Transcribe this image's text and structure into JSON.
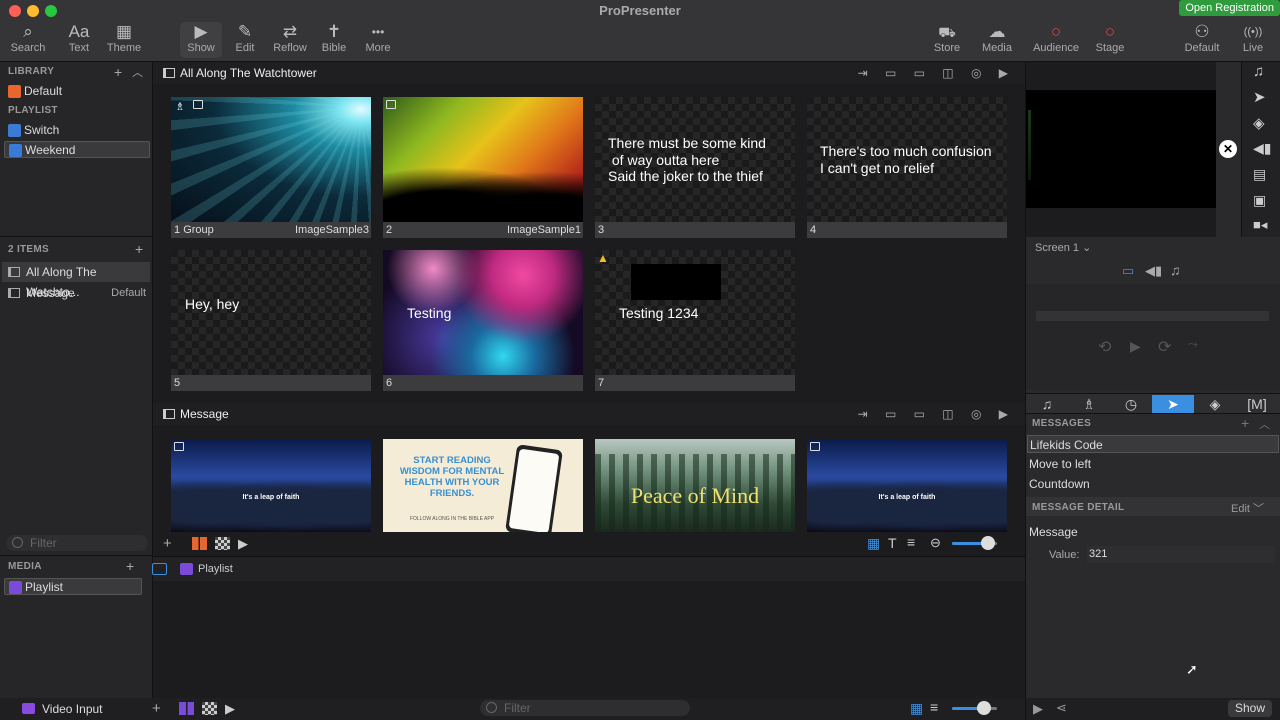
{
  "app": {
    "title": "ProPresenter",
    "registration": "Open Registration"
  },
  "toolbar": {
    "left": [
      {
        "label": "Search",
        "icon": "search-icon",
        "glyph": "⌕"
      },
      {
        "label": "Text",
        "icon": "text-icon",
        "glyph": "Aa"
      },
      {
        "label": "Theme",
        "icon": "theme-icon",
        "glyph": "▦"
      }
    ],
    "center": [
      {
        "label": "Show",
        "icon": "play-icon",
        "glyph": "▶"
      },
      {
        "label": "Edit",
        "icon": "pencil-icon",
        "glyph": "✎"
      },
      {
        "label": "Reflow",
        "icon": "reflow-icon",
        "glyph": "⇄"
      },
      {
        "label": "Bible",
        "icon": "bible-icon",
        "glyph": "✝"
      },
      {
        "label": "More",
        "icon": "more-icon",
        "glyph": "•••"
      }
    ],
    "right": [
      {
        "label": "Store",
        "icon": "store-icon",
        "glyph": "🛒"
      },
      {
        "label": "Media",
        "icon": "media-icon",
        "glyph": "☁"
      },
      {
        "label": "Audience",
        "icon": "audience-icon",
        "glyph": "○"
      },
      {
        "label": "Stage",
        "icon": "stage-icon",
        "glyph": "○"
      },
      {
        "label": "Default",
        "icon": "mask-icon",
        "glyph": "⚇"
      },
      {
        "label": "Live",
        "icon": "live-icon",
        "glyph": "((•))"
      }
    ]
  },
  "library": {
    "header": "LIBRARY",
    "items": [
      {
        "label": "Default"
      }
    ]
  },
  "playlist": {
    "header": "PLAYLIST",
    "items": [
      {
        "label": "Switch"
      },
      {
        "label": "Weekend"
      }
    ]
  },
  "items": {
    "header": "2 ITEMS",
    "list": [
      {
        "label": "All Along The Watchto...",
        "right": ""
      },
      {
        "label": "Message",
        "right": "Default"
      }
    ]
  },
  "filter_placeholder": "Filter",
  "media": {
    "header": "MEDIA",
    "items": [
      {
        "label": "Playlist"
      }
    ],
    "video_input": "Video Input"
  },
  "presentation": {
    "title": "All Along The Watchtower",
    "slides": [
      {
        "num": "1",
        "group": "Group",
        "name": "ImageSample3",
        "text": ""
      },
      {
        "num": "2",
        "group": "",
        "name": "ImageSample1",
        "text": ""
      },
      {
        "num": "3",
        "group": "",
        "name": "",
        "text": "There must be some kind\n of way outta here\nSaid the joker to the thief"
      },
      {
        "num": "4",
        "group": "",
        "name": "",
        "text": "There's too much confusion\nI can't get no relief"
      },
      {
        "num": "5",
        "group": "",
        "name": "",
        "text": "Hey, hey"
      },
      {
        "num": "6",
        "group": "",
        "name": "",
        "text": "Testing"
      },
      {
        "num": "7",
        "group": "",
        "name": "",
        "text": "Testing 1234"
      }
    ]
  },
  "message_section": {
    "title": "Message",
    "thumbs": [
      {
        "caption": "It's a leap of faith"
      },
      {
        "caption": "START READING WISDOM FOR MENTAL HEALTH WITH YOUR FRIENDS.",
        "sub": "FOLLOW ALONG IN THE BIBLE APP"
      },
      {
        "caption": "Peace of Mind"
      },
      {
        "caption": "It's a leap of faith"
      }
    ]
  },
  "media_bin": {
    "label": "Playlist"
  },
  "right": {
    "screen": "Screen 1",
    "messages_header": "MESSAGES",
    "messages": [
      {
        "label": "Lifekids Code"
      },
      {
        "label": "Move to left"
      },
      {
        "label": "Countdown"
      }
    ],
    "detail_header": "MESSAGE DETAIL",
    "detail_edit": "Edit",
    "detail_name": "Message",
    "value_label": "Value:",
    "value": "321",
    "show_button": "Show"
  }
}
